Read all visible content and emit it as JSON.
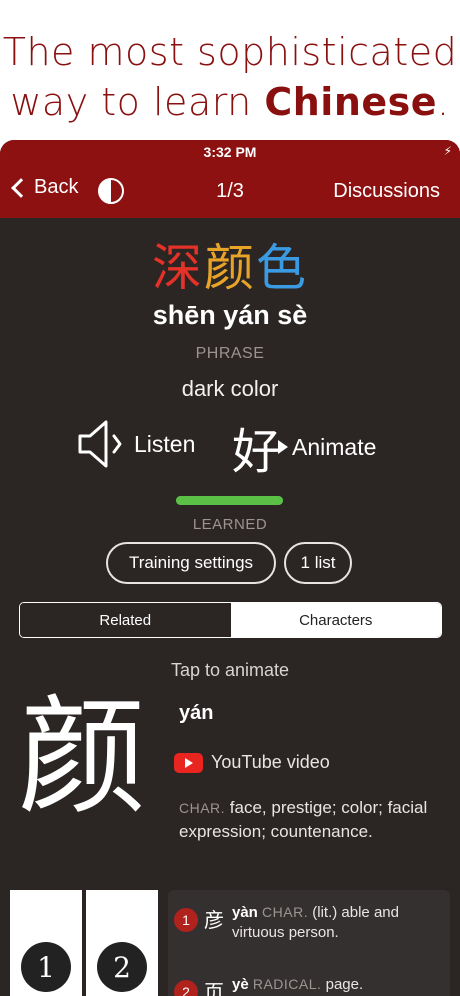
{
  "promo": {
    "line1": "The most sophisticated",
    "line2_prefix": "way to learn ",
    "line2_bold": "Chinese",
    "line2_suffix": "."
  },
  "status_bar": {
    "time": "3:32 PM",
    "charging_icon": "bolt-icon"
  },
  "nav": {
    "back_label": "Back",
    "counter": "1/3",
    "discussions_label": "Discussions",
    "contrast_icon": "contrast-icon"
  },
  "word": {
    "characters": [
      "深",
      "颜",
      "色"
    ],
    "character_colors": [
      "#e53228",
      "#e8a428",
      "#3b9be2"
    ],
    "pinyin": "shēn yán sè",
    "type": "PHRASE",
    "meaning": "dark color"
  },
  "actions": {
    "listen_label": "Listen",
    "animate_glyph": "好",
    "animate_label": "Animate"
  },
  "learning": {
    "status": "LEARNED",
    "progress": 1.0,
    "progress_color": "#5bc046"
  },
  "buttons": {
    "training_settings": "Training settings",
    "lists": "1 list"
  },
  "tabs": {
    "related": "Related",
    "characters": "Characters",
    "selected": "characters"
  },
  "character_detail": {
    "tap_hint": "Tap to animate",
    "glyph": "颜",
    "pinyin": "yán",
    "youtube_label": "YouTube video",
    "def_tag": "CHAR.",
    "definition": " face, prestige; color; facial expression; countenance."
  },
  "stroke_order": [
    {
      "number": "1"
    },
    {
      "number": "2"
    }
  ],
  "components": [
    {
      "number": "1",
      "glyph": "彦",
      "pinyin": "yàn",
      "tag": "CHAR.",
      "meaning": " (lit.) able and virtuous person."
    },
    {
      "number": "2",
      "glyph": "页",
      "pinyin": "yè",
      "tag": "RADICAL.",
      "meaning": " page."
    }
  ],
  "colors": {
    "brand_red": "#8d1111",
    "background": "#2b2524",
    "promo_text": "#8a1010"
  }
}
